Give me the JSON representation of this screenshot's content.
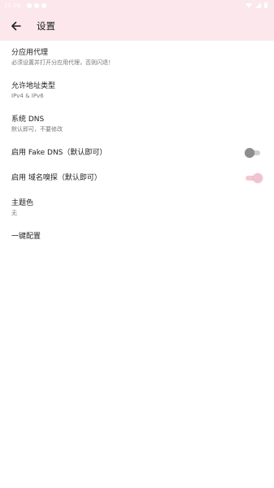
{
  "status_bar": {
    "time": "21:09",
    "icons": [
      "notification-icon",
      "notification-icon",
      "notification-icon",
      "wifi-icon",
      "signal-icon",
      "battery-icon"
    ]
  },
  "app_bar": {
    "back_icon": "arrow-back-icon",
    "title": "设置"
  },
  "settings": [
    {
      "title": "分应用代理",
      "subtitle": "必须设置并打开分应用代理，否则闪退！"
    },
    {
      "title": "允许地址类型",
      "subtitle": "IPv4 & IPv6"
    },
    {
      "title": "系统 DNS",
      "subtitle": "默认即可，不要修改"
    },
    {
      "title": "启用 Fake DNS（默认即可）",
      "toggle": false
    },
    {
      "title": "启用 域名嗅探（默认即可）",
      "toggle": true
    },
    {
      "title": "主题色",
      "subtitle": "无"
    },
    {
      "title": "一键配置"
    }
  ],
  "colors": {
    "app_bar_background": "#fbe7ec",
    "switch_on": "#f2c2cf",
    "switch_off": "#8d8d8d"
  }
}
